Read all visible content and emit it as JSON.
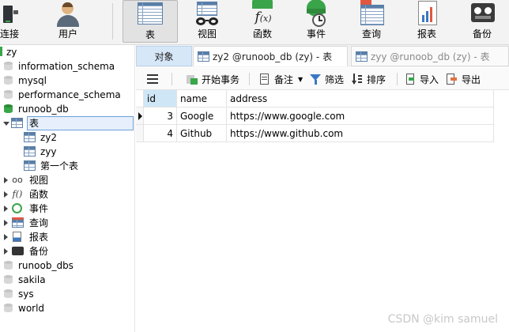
{
  "ribbon": {
    "items": [
      {
        "label": "连接",
        "icon": "connection-icon"
      },
      {
        "label": "用户",
        "icon": "user-icon"
      },
      {
        "label": "表",
        "icon": "table-icon",
        "active": true
      },
      {
        "label": "视图",
        "icon": "view-icon"
      },
      {
        "label": "函数",
        "icon": "function-icon"
      },
      {
        "label": "事件",
        "icon": "event-icon"
      },
      {
        "label": "查询",
        "icon": "query-icon"
      },
      {
        "label": "报表",
        "icon": "report-icon"
      },
      {
        "label": "备份",
        "icon": "backup-icon"
      }
    ]
  },
  "nav": {
    "connection": "zy",
    "databases": [
      {
        "name": "information_schema"
      },
      {
        "name": "mysql"
      },
      {
        "name": "performance_schema"
      },
      {
        "name": "runoob_db",
        "open": true
      }
    ],
    "tables_folder": "表",
    "tables": [
      "zy2",
      "zyy",
      "第一个表"
    ],
    "folders": [
      "视图",
      "函数",
      "事件",
      "查询",
      "报表",
      "备份"
    ],
    "more_databases": [
      "runoob_dbs",
      "sakila",
      "sys",
      "world"
    ]
  },
  "tabs": {
    "objects": "对象",
    "tab1": "zy2 @runoob_db (zy) - 表",
    "tab2": "zyy @runoob_db (zy) - 表"
  },
  "toolbar": {
    "begin_transaction": "开始事务",
    "memo": "备注",
    "filter": "筛选",
    "sort": "排序",
    "import": "导入",
    "export": "导出"
  },
  "table": {
    "columns": [
      "id",
      "name",
      "address"
    ],
    "rows": [
      {
        "id": "3",
        "name": "Google",
        "address": "https://www.google.com"
      },
      {
        "id": "4",
        "name": "Github",
        "address": "https://www.github.com"
      }
    ]
  },
  "watermark": "CSDN @kim samuel",
  "colors": {
    "selection": "#e6effb",
    "selection_border": "#6f9fd8",
    "active_db": "#39a649",
    "header_highlight": "#cfe6f6"
  }
}
